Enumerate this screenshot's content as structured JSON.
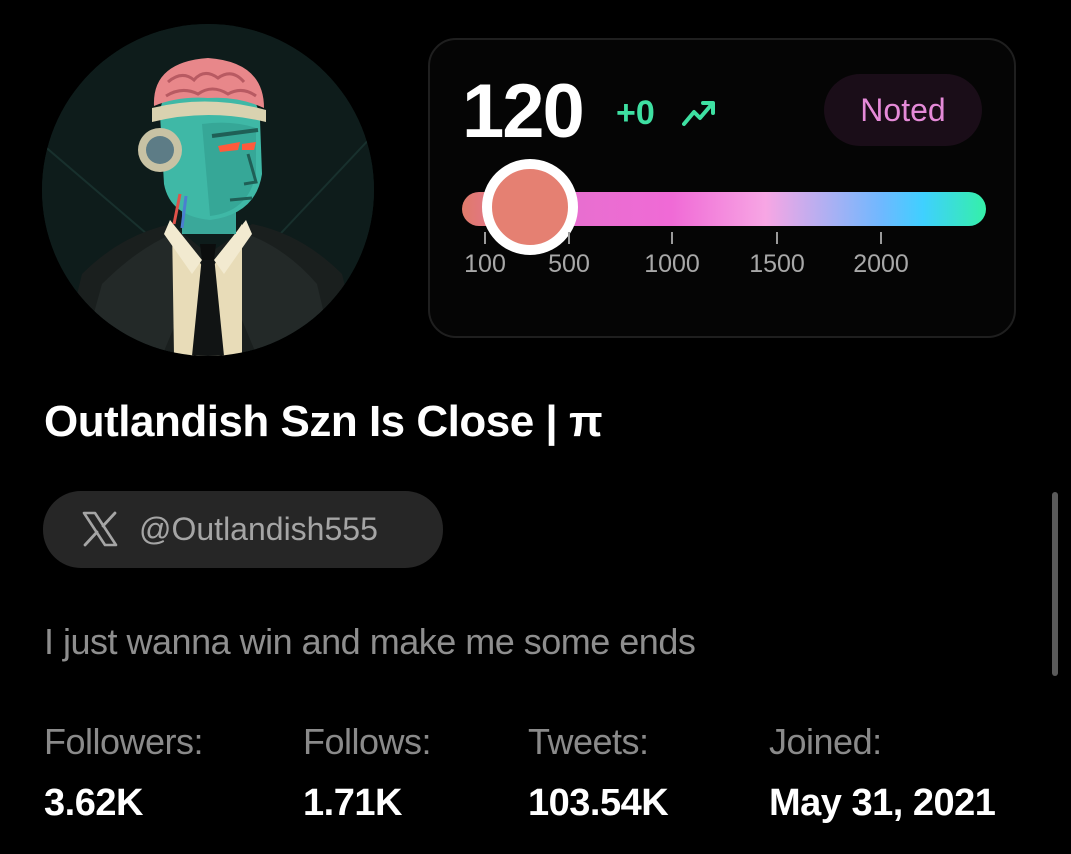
{
  "profile": {
    "avatar_icon": "robot-brain-avatar",
    "display_name": "Outlandish Szn Is Close | π",
    "handle_icon": "x-logo-icon",
    "handle": "@Outlandish555",
    "bio": "I just wanna win and make me some ends"
  },
  "score": {
    "value": "120",
    "delta": "+0",
    "trend_icon": "trend-up-icon",
    "noted_label": "Noted",
    "slider": {
      "min": 100,
      "max": 2000,
      "current": 120,
      "ticks": [
        "100",
        "500",
        "1000",
        "1500",
        "2000"
      ]
    }
  },
  "stats": {
    "followers_label": "Followers:",
    "followers_value": "3.62K",
    "follows_label": "Follows:",
    "follows_value": "1.71K",
    "tweets_label": "Tweets:",
    "tweets_value": "103.54K",
    "joined_label": "Joined:",
    "joined_value": "May 31, 2021"
  },
  "colors": {
    "background": "#000000",
    "accent_green": "#3ee0a2",
    "noted_pink": "#e58ad8",
    "thumb": "#e58072"
  }
}
